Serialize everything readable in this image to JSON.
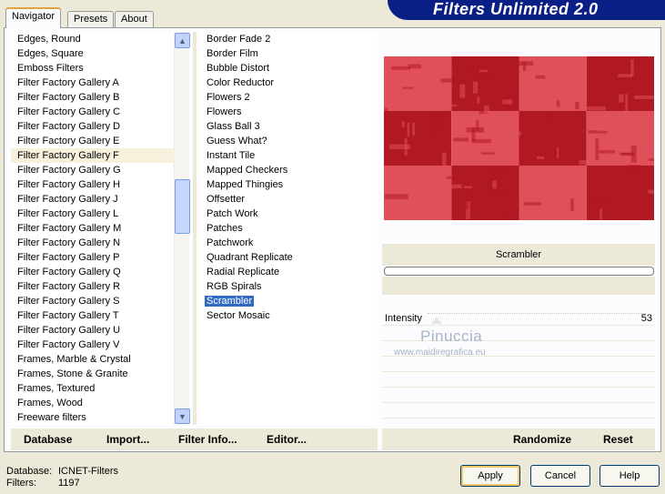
{
  "tabs": [
    {
      "label": "Navigator",
      "active": true
    },
    {
      "label": "Presets",
      "active": false
    },
    {
      "label": "About",
      "active": false
    }
  ],
  "banner": {
    "title": "Filters Unlimited 2.0"
  },
  "categories": {
    "items": [
      "Edges, Round",
      "Edges, Square",
      "Emboss Filters",
      "Filter Factory Gallery A",
      "Filter Factory Gallery B",
      "Filter Factory Gallery C",
      "Filter Factory Gallery D",
      "Filter Factory Gallery E",
      "Filter Factory Gallery F",
      "Filter Factory Gallery G",
      "Filter Factory Gallery H",
      "Filter Factory Gallery J",
      "Filter Factory Gallery L",
      "Filter Factory Gallery M",
      "Filter Factory Gallery N",
      "Filter Factory Gallery P",
      "Filter Factory Gallery Q",
      "Filter Factory Gallery R",
      "Filter Factory Gallery S",
      "Filter Factory Gallery T",
      "Filter Factory Gallery U",
      "Filter Factory Gallery V",
      "Frames, Marble & Crystal",
      "Frames, Stone & Granite",
      "Frames, Textured",
      "Frames, Wood",
      "Freeware filters"
    ],
    "highlighted": "Filter Factory Gallery F"
  },
  "filters": {
    "items": [
      "Border Fade 2",
      "Border Film",
      "Bubble Distort",
      "Color Reductor",
      "Flowers 2",
      "Flowers",
      "Glass Ball 3",
      "Guess What?",
      "Instant Tile",
      "Mapped Checkers",
      "Mapped Thingies",
      "Offsetter",
      "Patch Work",
      "Patches",
      "Patchwork",
      "Quadrant Replicate",
      "Radial Replicate",
      "RGB Spirals",
      "Scrambler",
      "Sector Mosaic"
    ],
    "selected": "Scrambler"
  },
  "preview": {
    "colors": {
      "light": "#e0505a",
      "dark": "#b01822"
    }
  },
  "filter_panel": {
    "name": "Scrambler",
    "param": {
      "label": "Intensity",
      "value": "53"
    }
  },
  "watermark": {
    "name": "Pinuccia",
    "url": "www.maidiregrafica.eu"
  },
  "bottom_links": {
    "database": "Database",
    "import": "Import...",
    "filter_info": "Filter Info...",
    "editor": "Editor...",
    "randomize": "Randomize",
    "reset": "Reset"
  },
  "status": {
    "database_label": "Database:",
    "database_value": "ICNET-Filters",
    "filters_label": "Filters:",
    "filters_value": "1197"
  },
  "buttons": {
    "apply": "Apply",
    "cancel": "Cancel",
    "help": "Help"
  },
  "icons": {
    "scroll_up": "chevron-up-icon",
    "scroll_down": "chevron-down-icon"
  }
}
